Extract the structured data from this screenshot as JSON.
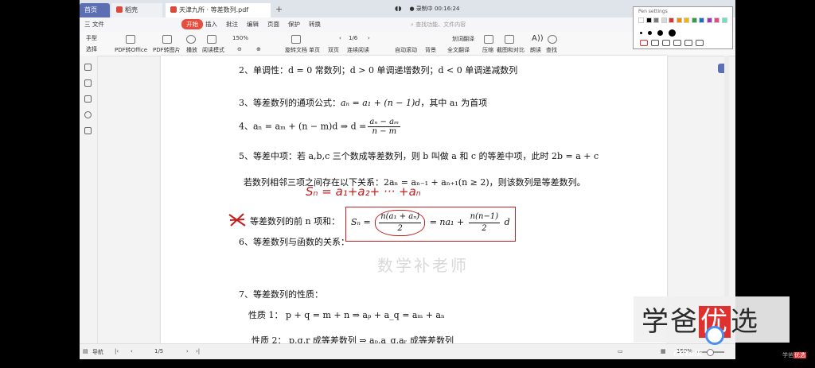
{
  "tabs": {
    "home": "首页",
    "tab2": "稻壳",
    "tab3": "天津九所 · 等差数列.pdf",
    "add": "+"
  },
  "recording": {
    "mic": "◖◗",
    "label": "● 录制中 00:16:24"
  },
  "menu": {
    "file": "三 文件",
    "items": [
      "开始",
      "插入",
      "批注",
      "编辑",
      "页面",
      "保护",
      "转换"
    ],
    "active_index": 0,
    "search": "查找功能、文件内容"
  },
  "toolbar": {
    "left_top": "手型",
    "left_bottom": "选择",
    "pdf_office": "PDF转Office",
    "pdf_image": "PDF转图片",
    "play": "播放",
    "read_mode": "阅读模式",
    "zoom": "150%",
    "rotate": "旋转文档",
    "single": "单页",
    "double": "双页",
    "continuous": "连续阅读",
    "page": "1/6",
    "auto_scroll": "自动滚动",
    "background": "背景",
    "translate": "划词翻译",
    "full_translate": "全文翻译",
    "compress": "压缩",
    "screenshot": "截图和对比",
    "read_aloud": "朗读",
    "find": "查找"
  },
  "doc": {
    "l1": "2、单调性：d = 0 常数列；d > 0 单调递增数列；d < 0 单调递减数列",
    "l2a": "3、等差数列的通项公式：",
    "l2b": "aₙ = a₁ + (n − 1)d",
    "l2c": "，其中 a₁ 为首项",
    "l3a": "4、aₙ = aₘ + (n − m)d ⇒ d =",
    "l3n": "aₙ − aₘ",
    "l3d": "n − m",
    "l4": "5、等差中项：若 a,b,c 三个数成等差数列，则 b 叫做 a 和 c 的等差中项，此时 2b = a + c",
    "l5": "若数列相邻三项之间存在以下关系：2aₙ = aₙ₋₁ + aₙ₊₁(n ≥ 2)，则该数列是等差数列。",
    "hw_sum": "Sₙ = a₁+a₂+ ··· +aₙ",
    "l6a": "等差数列的前 n 项和：",
    "l6b": "Sₙ =",
    "l6n1": "n(a₁ + aₙ)",
    "l6d1": "2",
    "l6c": "= na₁ +",
    "l6n2": "n(n−1)",
    "l6d2": "2",
    "l6e": "d",
    "l7": "6、等差数列与函数的关系：",
    "watermark": "数学补老师",
    "l8": "7、等差数列的性质：",
    "l9": "性质 1：  p + q = m + n ⇒ aₚ + a_q = aₘ + aₙ",
    "l10": "性质 2：  p,q,r 成等差数列 ⇒ aₚ,a_q,aᵣ 成等差数列"
  },
  "status": {
    "nav": "导航",
    "page": "1/5",
    "zoom": "150%"
  },
  "palette": {
    "title": "Pen settings",
    "colors": [
      "#ffffff",
      "#000000",
      "#7a7a7a",
      "#d9d9d9",
      "#e03131",
      "#f08c00",
      "#fab005",
      "#2f9e44",
      "#1971c2",
      "#9c36b5",
      "#e64980",
      "#63e6be"
    ]
  },
  "logo": {
    "a": "学爸",
    "b": "优",
    "c": "选"
  },
  "cctalk": "CCtalk",
  "corner": {
    "a": "学爸",
    "b": "优选"
  }
}
